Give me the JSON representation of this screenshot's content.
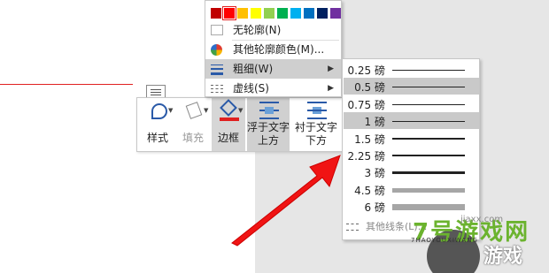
{
  "colors": {
    "swatches": [
      "#c00000",
      "#ff0000",
      "#ffc000",
      "#ffff00",
      "#92d050",
      "#00b050",
      "#00b0f0",
      "#0070c0",
      "#002060",
      "#7030a0"
    ],
    "accent_red": "#e02020",
    "highlight": "#cfcfcf"
  },
  "menu": {
    "no_outline": "无轮廓(N)",
    "more_colors": "其他轮廓颜色(M)...",
    "weight": "粗细(W)",
    "dashes": "虚线(S)"
  },
  "weights": [
    {
      "label": "0.25 磅",
      "pt": 0.25,
      "selected": false
    },
    {
      "label": "0.5 磅",
      "pt": 0.5,
      "selected": true
    },
    {
      "label": "0.75 磅",
      "pt": 0.75,
      "selected": false
    },
    {
      "label": "1 磅",
      "pt": 1,
      "selected": true
    },
    {
      "label": "1.5 磅",
      "pt": 1.5,
      "selected": false
    },
    {
      "label": "2.25 磅",
      "pt": 2.25,
      "selected": false
    },
    {
      "label": "3 磅",
      "pt": 3,
      "selected": false
    },
    {
      "label": "4.5 磅",
      "pt": 4.5,
      "selected": false
    },
    {
      "label": "6 磅",
      "pt": 6,
      "selected": false
    }
  ],
  "more_lines": "其他线条(L)...",
  "toolbar": {
    "style": "样式",
    "fill": "填充",
    "border": "边框",
    "in_front_1": "浮于文字",
    "in_front_2": "上方",
    "behind_1": "衬于文字",
    "behind_2": "下方"
  },
  "watermark": {
    "brand": "7号游戏网",
    "sub": "游戏",
    "pinyin": "7HAOYOUXIWANG",
    "url": "jiaxx.com"
  }
}
